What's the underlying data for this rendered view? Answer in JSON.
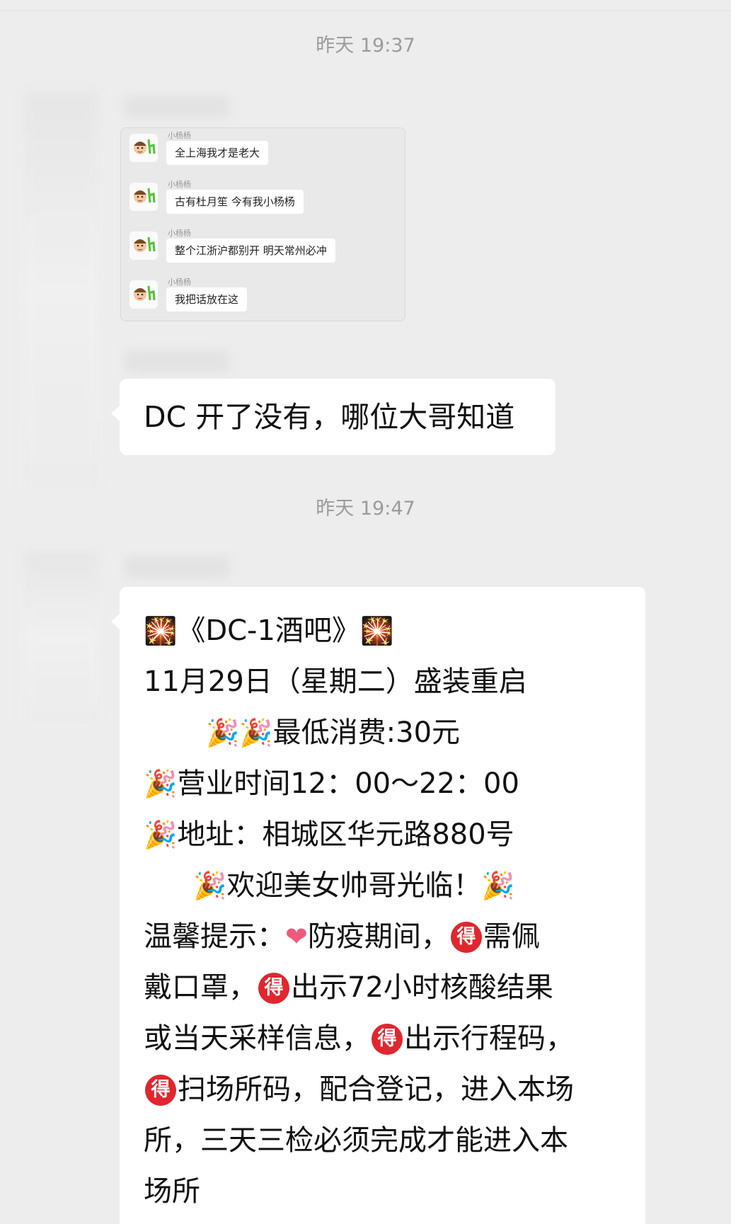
{
  "timestamps": [
    "昨天 19:37",
    "昨天 19:47"
  ],
  "forwarded_chat": {
    "messages": [
      {
        "sender": "小杨杨",
        "text": "全上海我才是老大"
      },
      {
        "sender": "小杨杨",
        "text": "古有杜月笙 今有我小杨杨"
      },
      {
        "sender": "小杨杨",
        "text": "整个江浙沪都别开 明天常州必冲"
      },
      {
        "sender": "小杨杨",
        "text": "我把话放在这"
      }
    ]
  },
  "message1": "DC 开了没有，哪位大哥知道",
  "message2": {
    "line1": "《DC-1酒吧》",
    "line2": "11月29日（星期二）盛装重启",
    "line3": "最低消费:30元",
    "line4": "营业时间12：00～22：00",
    "line5": "地址：相城区华元路880号",
    "line6": "欢迎美女帅哥光临！",
    "line7a": "温馨提示：",
    "line7b": "防疫期间，",
    "line7c": "需佩",
    "line8a": "戴口罩，",
    "line8b": "出示72小时核酸结果",
    "line9a": "或当天采样信息，",
    "line9b": "出示行程码，",
    "line10": "扫场所码，配合登记，进入本场",
    "line11": "所，三天三检必须完成才能进入本",
    "line12": "场所"
  },
  "icons": {
    "fireworks": "🎇",
    "party": "🎉",
    "heart": "❤",
    "de_badge": "得"
  },
  "colors": {
    "background": "#ededed",
    "bubble": "#ffffff",
    "timestamp": "#9b9b9b",
    "badge": "#e0262e"
  }
}
